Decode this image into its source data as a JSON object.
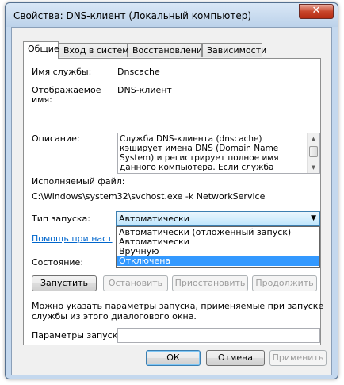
{
  "window": {
    "title": "Свойства: DNS-клиент (Локальный компьютер)",
    "close_glyph": "✕"
  },
  "tabs": [
    {
      "label": "Общие",
      "active": true
    },
    {
      "label": "Вход в систему",
      "active": false
    },
    {
      "label": "Восстановление",
      "active": false
    },
    {
      "label": "Зависимости",
      "active": false
    }
  ],
  "general": {
    "service_name_label": "Имя службы:",
    "service_name_value": "Dnscache",
    "display_name_label_line1": "Отображаемое",
    "display_name_label_line2": "имя:",
    "display_name_value": "DNS-клиент",
    "description_label": "Описание:",
    "description_text": "Служба DNS-клиента (dnscache) кэширует имена DNS (Domain Name System) и регистрирует полное имя данного компьютера. Если служба остановлена, разрешение имен",
    "exe_label": "Исполняемый файл:",
    "exe_path": "C:\\Windows\\system32\\svchost.exe -k NetworkService",
    "startup_type_label": "Тип запуска:",
    "startup_type_selected": "Автоматически",
    "startup_options": [
      "Автоматически (отложенный запуск)",
      "Автоматически",
      "Вручную",
      "Отключена"
    ],
    "startup_highlighted_index": 3,
    "help_link": "Помощь при наст",
    "status_label": "Состояние:",
    "buttons": {
      "start": "Запустить",
      "stop": "Остановить",
      "pause": "Приостановить",
      "resume": "Продолжить"
    },
    "hint_line1": "Можно указать параметры запуска, применяемые при запуске",
    "hint_line2": "службы из этого диалогового окна.",
    "params_label": "Параметры запуска:",
    "params_value": ""
  },
  "footer": {
    "ok": "ОК",
    "cancel": "Отмена",
    "apply": "Применить"
  },
  "icons": {
    "dropdown_arrow": "▼",
    "scroll_up": "▲",
    "scroll_down": "▼"
  }
}
